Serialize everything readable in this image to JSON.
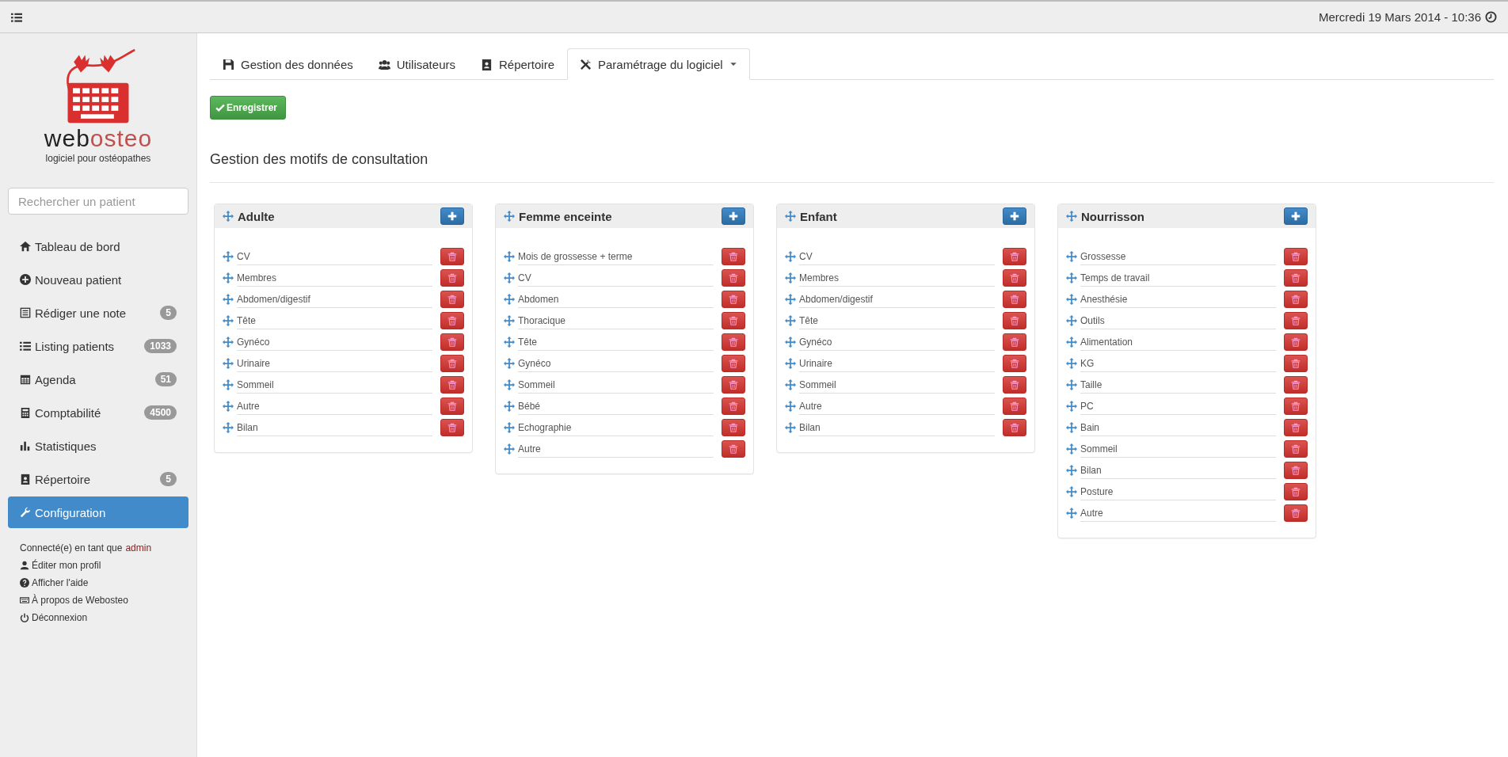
{
  "topbar": {
    "datetime": "Mercredi 19 Mars 2014 - 10:36"
  },
  "sidebar": {
    "logo": {
      "part1": "web",
      "part2": "osteo",
      "tagline": "logiciel pour ostéopathes"
    },
    "search": {
      "placeholder": "Rechercher un patient"
    },
    "items": [
      {
        "label": "Tableau de bord",
        "selected": false
      },
      {
        "label": "Nouveau patient",
        "selected": false
      },
      {
        "label": "Rédiger une note",
        "badge": "5",
        "selected": false
      },
      {
        "label": "Listing patients",
        "badge": "1033",
        "selected": false
      },
      {
        "label": "Agenda",
        "badge": "51",
        "selected": false
      },
      {
        "label": "Comptabilité",
        "badge": "4500",
        "selected": false
      },
      {
        "label": "Statistiques",
        "selected": false
      },
      {
        "label": "Répertoire",
        "badge": "5",
        "selected": false
      },
      {
        "label": "Configuration",
        "selected": true
      }
    ],
    "user": {
      "prefix": "Connecté(e) en tant que",
      "name": "admin"
    },
    "links": [
      "Éditer mon profil",
      "Afficher l'aide",
      "À propos de Webosteo",
      "Déconnexion"
    ]
  },
  "tabs": [
    {
      "label": "Gestion des données",
      "selected": false
    },
    {
      "label": "Utilisateurs",
      "selected": false
    },
    {
      "label": "Répertoire",
      "selected": false
    },
    {
      "label": "Paramétrage du logiciel",
      "selected": true,
      "dropdown": true
    }
  ],
  "save_button": "Enregistrer",
  "heading": "Gestion des motifs de consultation",
  "panels": [
    {
      "title": "Adulte",
      "items": [
        "CV",
        "Membres",
        "Abdomen/digestif",
        "Tête",
        "Gynéco",
        "Urinaire",
        "Sommeil",
        "Autre",
        "Bilan"
      ]
    },
    {
      "title": "Femme enceinte",
      "items": [
        "Mois de grossesse + terme",
        "CV",
        "Abdomen",
        "Thoracique",
        "Tête",
        "Gynéco",
        "Sommeil",
        "Bébé",
        "Echographie",
        "Autre"
      ]
    },
    {
      "title": "Enfant",
      "items": [
        "CV",
        "Membres",
        "Abdomen/digestif",
        "Tête",
        "Gynéco",
        "Urinaire",
        "Sommeil",
        "Autre",
        "Bilan"
      ]
    },
    {
      "title": "Nourrisson",
      "items": [
        "Grossesse",
        "Temps de travail",
        "Anesthésie",
        "Outils",
        "Alimentation",
        "KG",
        "Taille",
        "PC",
        "Bain",
        "Sommeil",
        "Bilan",
        "Posture",
        "Autre"
      ]
    }
  ]
}
